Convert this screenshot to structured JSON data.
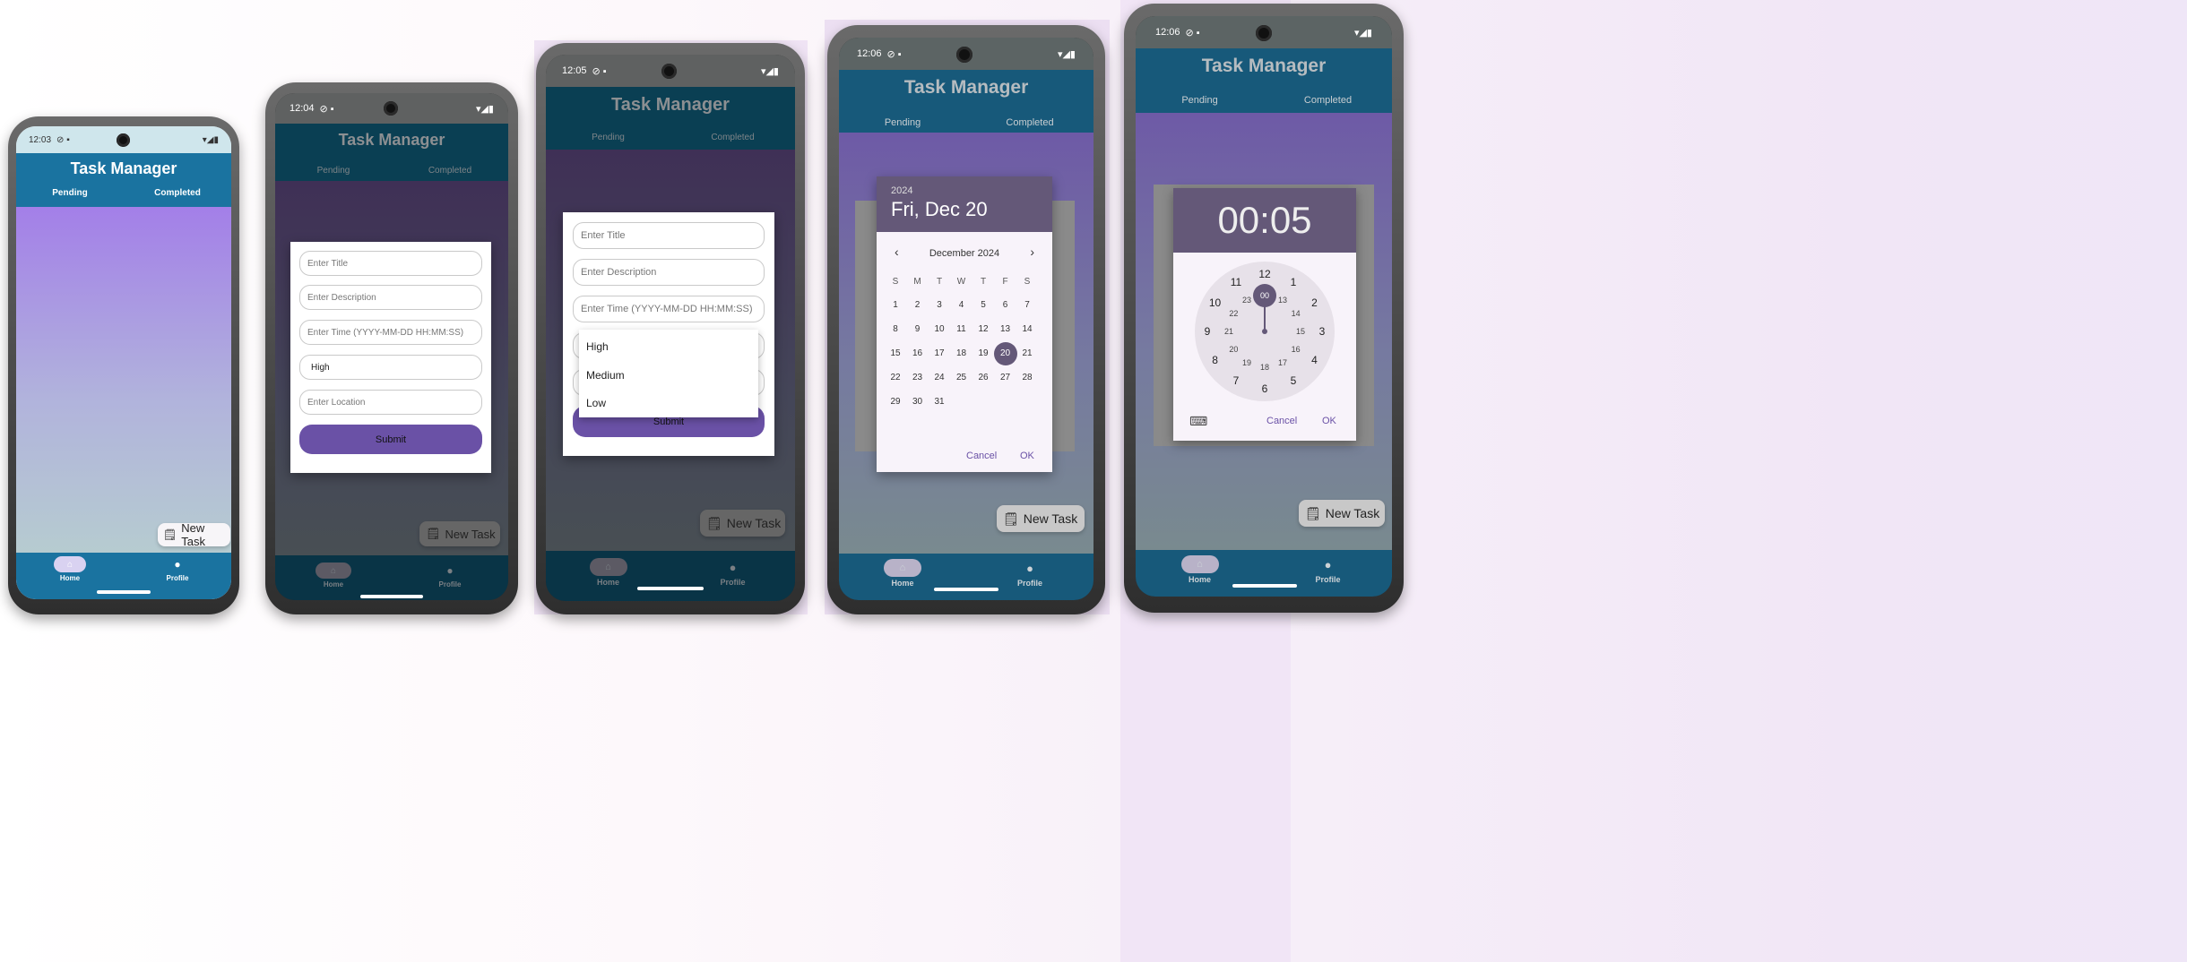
{
  "app_title": "Task Manager",
  "tabs": {
    "pending": "Pending",
    "completed": "Completed"
  },
  "nav": {
    "home": "Home",
    "profile": "Profile"
  },
  "fab_label": "New Task",
  "form": {
    "title_placeholder": "Enter Title",
    "description_placeholder": "Enter Description",
    "time_placeholder": "Enter Time (YYYY-MM-DD HH:MM:SS)",
    "priority_value": "High",
    "location_placeholder": "Enter Location",
    "submit_label": "Submit"
  },
  "priority_options": [
    "High",
    "Medium",
    "Low"
  ],
  "phones": [
    {
      "time": "12:03"
    },
    {
      "time": "12:04"
    },
    {
      "time": "12:05"
    },
    {
      "time": "12:06"
    },
    {
      "time": "12:06"
    }
  ],
  "date_picker": {
    "year": "2024",
    "date": "Fri, Dec 20",
    "month": "December 2024",
    "weekdays": [
      "S",
      "M",
      "T",
      "W",
      "T",
      "F",
      "S"
    ],
    "days": [
      "1",
      "2",
      "3",
      "4",
      "5",
      "6",
      "7",
      "8",
      "9",
      "10",
      "11",
      "12",
      "13",
      "14",
      "15",
      "16",
      "17",
      "18",
      "19",
      "20",
      "21",
      "22",
      "23",
      "24",
      "25",
      "26",
      "27",
      "28",
      "29",
      "30",
      "31"
    ],
    "selected": "20",
    "cancel": "Cancel",
    "ok": "OK"
  },
  "time_picker": {
    "time": "00:05",
    "outer": [
      "12",
      "1",
      "2",
      "3",
      "4",
      "5",
      "6",
      "7",
      "8",
      "9",
      "10",
      "11"
    ],
    "inner": [
      "00",
      "13",
      "14",
      "15",
      "16",
      "17",
      "18",
      "19",
      "20",
      "21",
      "22",
      "23"
    ],
    "cancel": "Cancel",
    "ok": "OK"
  },
  "colors": {
    "header_blue": "#1a73a0",
    "accent_purple": "#6a51a6",
    "lavender_top": "#a37fe8",
    "lavender_bottom": "#b6ccd0",
    "picker_header": "#645878"
  }
}
